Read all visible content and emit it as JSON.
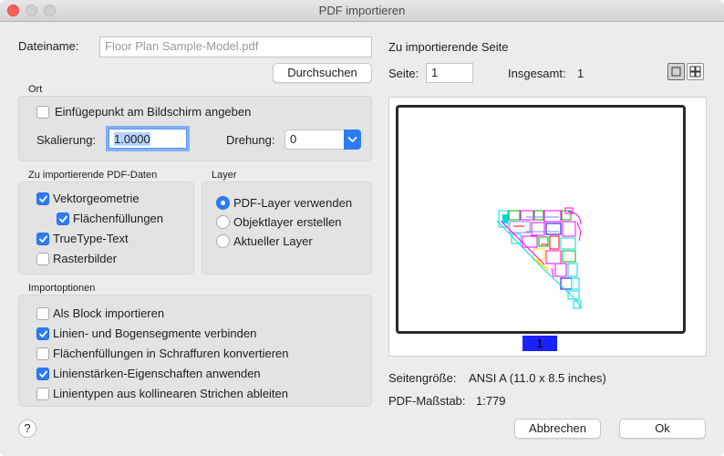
{
  "window": {
    "title": "PDF importieren"
  },
  "file": {
    "label": "Dateiname:",
    "value": "Floor Plan Sample-Model.pdf",
    "browse_label": "Durchsuchen"
  },
  "location": {
    "heading": "Ort",
    "specify_on_screen_label": "Einfügepunkt am Bildschirm angeben",
    "specify_on_screen_checked": false,
    "scale_label": "Skalierung:",
    "scale_value": "1.0000",
    "rotation_label": "Drehung:",
    "rotation_value": "0"
  },
  "pdf_data": {
    "heading": "Zu importierende PDF-Daten",
    "items": [
      {
        "label": "Vektorgeometrie",
        "checked": true
      },
      {
        "label": "Flächenfüllungen",
        "checked": true
      },
      {
        "label": "TrueType-Text",
        "checked": true
      },
      {
        "label": "Rasterbilder",
        "checked": false
      }
    ]
  },
  "layer": {
    "heading": "Layer",
    "options": [
      {
        "label": "PDF-Layer verwenden",
        "selected": true
      },
      {
        "label": "Objektlayer erstellen",
        "selected": false
      },
      {
        "label": "Aktueller Layer",
        "selected": false
      }
    ]
  },
  "import_options": {
    "heading": "Importoptionen",
    "items": [
      {
        "label": "Als Block importieren",
        "checked": false
      },
      {
        "label": "Linien- und Bogensegmente verbinden",
        "checked": true
      },
      {
        "label": "Flächenfüllungen in Schraffuren konvertieren",
        "checked": false
      },
      {
        "label": "Linienstärken-Eigenschaften anwenden",
        "checked": true
      },
      {
        "label": "Linientypen aus kollinearen Strichen ableiten",
        "checked": false
      }
    ]
  },
  "page_section": {
    "heading": "Zu importierende Seite",
    "page_label": "Seite:",
    "page_value": "1",
    "total_label": "Insgesamt:",
    "total_value": "1",
    "thumbnail_page_number": "1",
    "page_size_label": "Seitengröße:",
    "page_size_value": "ANSI A (11.0 x 8.5 inches)",
    "scale_label": "PDF-Maßstab:",
    "scale_value": "1:779"
  },
  "footer": {
    "help_label": "?",
    "cancel_label": "Abbrechen",
    "ok_label": "Ok"
  },
  "colors": {
    "accent": "#2b7cf6",
    "page_badge": "#1a22ff"
  },
  "icons": {
    "single_view": "single-page-icon",
    "grid_view": "grid-pages-icon",
    "check": "checkmark-icon",
    "dropdown": "chevron-down-icon"
  }
}
